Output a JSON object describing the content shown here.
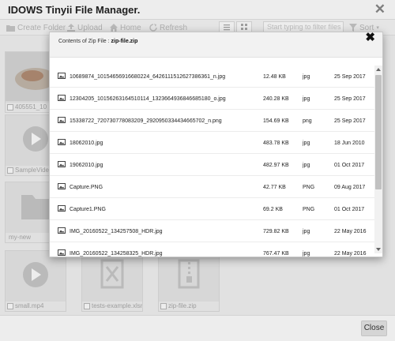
{
  "outer": {
    "title": "IDOWS Tinyii File Manager.",
    "close_glyph": "✕",
    "close_button_label": "Close"
  },
  "toolbar": {
    "create_folder": "Create Folder",
    "upload": "Upload",
    "home": "Home",
    "refresh": "Refresh",
    "filter_placeholder": "Start typing to filter files",
    "sort": "Sort"
  },
  "background_files": [
    {
      "name": "405551_10",
      "icon": "image-thumbnail-icon"
    },
    {
      "name": "SampleVideo",
      "icon": "video-icon"
    },
    {
      "name": "my-new",
      "icon": "folder-icon"
    },
    {
      "name": "small.mp4",
      "icon": "video-icon"
    },
    {
      "name": "tests-example.xlsm",
      "icon": "excel-icon"
    },
    {
      "name": "zip-file.zip",
      "icon": "zip-icon"
    }
  ],
  "zip_modal": {
    "title_prefix": "Contents of Zip File :",
    "title_filename": "zip-file.zip",
    "close_glyph": "✖",
    "files": [
      {
        "name": "10689874_10154656916680224_6426111512627386361_n.jpg",
        "size": "12.48 KB",
        "type": "jpg",
        "date": "25 Sep 2017"
      },
      {
        "name": "12304205_10156263164510114_1323664936846685180_o.jpg",
        "size": "240.28 KB",
        "type": "jpg",
        "date": "25 Sep 2017"
      },
      {
        "name": "15338722_720730778083209_2920950334434665702_n.png",
        "size": "154.69 KB",
        "type": "png",
        "date": "25 Sep 2017"
      },
      {
        "name": "18062010.jpg",
        "size": "483.78 KB",
        "type": "jpg",
        "date": "18 Jun 2010"
      },
      {
        "name": "19062010.jpg",
        "size": "482.97 KB",
        "type": "jpg",
        "date": "01 Oct 2017"
      },
      {
        "name": "Capture.PNG",
        "size": "42.77 KB",
        "type": "PNG",
        "date": "09 Aug 2017"
      },
      {
        "name": "Capture1.PNG",
        "size": "69.2 KB",
        "type": "PNG",
        "date": "01 Oct 2017"
      },
      {
        "name": "IMG_20160522_134257508_HDR.jpg",
        "size": "729.82 KB",
        "type": "jpg",
        "date": "22 May 2016"
      },
      {
        "name": "IMG_20160522_134258325_HDR.jpg",
        "size": "767.47 KB",
        "type": "jpg",
        "date": "22 May 2016"
      }
    ]
  }
}
